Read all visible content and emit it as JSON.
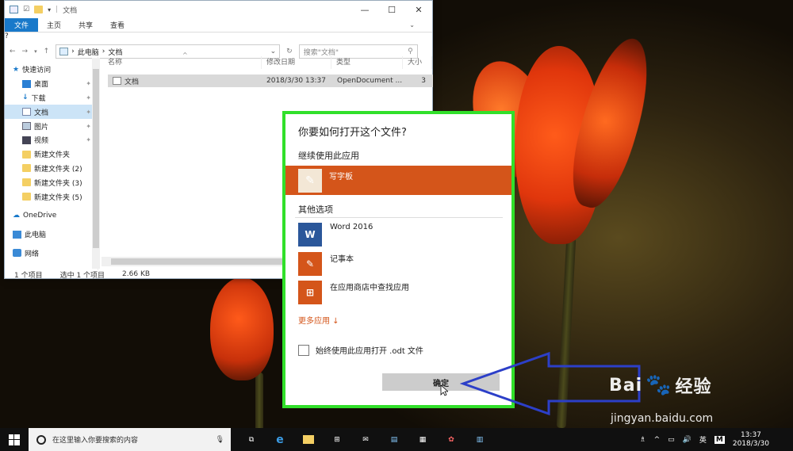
{
  "explorer": {
    "title": "文档",
    "ribbon_tabs": [
      "文件",
      "主页",
      "共享",
      "查看"
    ],
    "breadcrumb": [
      "此电脑",
      "文档"
    ],
    "search_placeholder": "搜索\"文档\"",
    "nav_items": [
      {
        "label": "快速访问",
        "icon": "star-icon",
        "pinned": false
      },
      {
        "label": "桌面",
        "icon": "desktop-icon",
        "pinned": true
      },
      {
        "label": "下载",
        "icon": "download-icon",
        "pinned": true
      },
      {
        "label": "文档",
        "icon": "document-icon",
        "pinned": true,
        "selected": true
      },
      {
        "label": "图片",
        "icon": "pictures-icon",
        "pinned": true
      },
      {
        "label": "视频",
        "icon": "video-icon",
        "pinned": true
      },
      {
        "label": "新建文件夹",
        "icon": "folder-icon",
        "pinned": false
      },
      {
        "label": "新建文件夹 (2)",
        "icon": "folder-icon",
        "pinned": false
      },
      {
        "label": "新建文件夹 (3)",
        "icon": "folder-icon",
        "pinned": false
      },
      {
        "label": "新建文件夹 (5)",
        "icon": "folder-icon",
        "pinned": false
      },
      {
        "label": "OneDrive",
        "icon": "onedrive-icon",
        "pinned": false
      },
      {
        "label": "此电脑",
        "icon": "pc-icon",
        "pinned": false
      },
      {
        "label": "网络",
        "icon": "network-icon",
        "pinned": false
      }
    ],
    "columns": [
      "名称",
      "修改日期",
      "类型",
      "大小"
    ],
    "files": [
      {
        "name": "文档",
        "modified": "2018/3/30 13:37",
        "type": "OpenDocument ...",
        "size": "3"
      }
    ],
    "status": {
      "count": "1 个项目",
      "selected": "选中 1 个项目",
      "size": "2.66 KB"
    }
  },
  "dialog": {
    "title": "你要如何打开这个文件?",
    "continue_heading": "继续使用此应用",
    "current_app": "写字板",
    "other_heading": "其他选项",
    "apps": [
      {
        "label": "Word 2016",
        "icon": "word-icon",
        "color": "#2b579a"
      },
      {
        "label": "记事本",
        "icon": "notepad-icon",
        "color": "#d4551a"
      },
      {
        "label": "在应用商店中查找应用",
        "icon": "store-icon",
        "color": "#d4551a"
      }
    ],
    "more_apps": "更多应用 ↓",
    "always_use": "始终使用此应用打开 .odt 文件",
    "ok": "确定",
    "accent": "#d4551a",
    "highlight_color": "#31e02a"
  },
  "watermark": {
    "brand": "Bai",
    "brand2": "经验",
    "url": "jingyan.baidu.com"
  },
  "taskbar": {
    "search_placeholder": "在这里输入你要搜索的内容",
    "ime": "英",
    "ime2": "M",
    "time": "13:37",
    "date": "2018/3/30"
  }
}
